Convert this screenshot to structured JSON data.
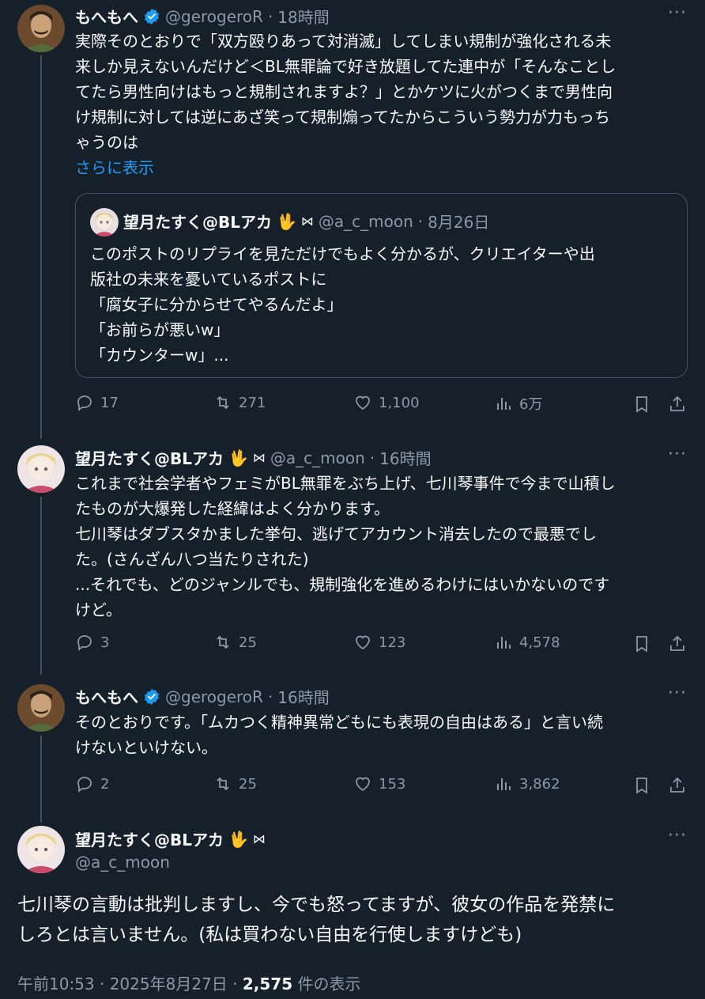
{
  "tweet1": {
    "name": "もへもへ",
    "handle": "@gerogeroR",
    "time": "18時間",
    "body": "実際そのとおりで「双方殴りあって対消滅」してしまい規制が強化される未\n来しか見えないんだけど＜BL無罪論で好き放題してた連中が「そんなことし\nてたら男性向けはもっと規制されますよ？」とかケツに火がつくまで男性向\nけ規制に対しては逆にあざ笑って規制煽ってたからこういう勢力が力もっち\nゃうのは",
    "show_more": "さらに表示",
    "quote": {
      "name": "望月たすく@BLアカ",
      "handle": "@a_c_moon",
      "time": "8月26日",
      "body": "このポストのリプライを見ただけでもよく分かるが、クリエイターや出\n版社の未来を憂いているポストに\n「腐女子に分からせてやるんだよ」\n「お前らが悪いw」\n「カウンターw」..."
    },
    "stats": {
      "replies": "17",
      "reposts": "271",
      "likes": "1,100",
      "views": "6万"
    }
  },
  "tweet2": {
    "name": "望月たすく@BLアカ",
    "handle": "@a_c_moon",
    "time": "16時間",
    "body": "これまで社会学者やフェミがBL無罪をぶち上げ、七川琴事件で今まで山積し\nたものが大爆発した経緯はよく分かります。\n七川琴はダブスタかました挙句、逃げてアカウント消去したので最悪でし\nた。(さんざん八つ当たりされた)\n...それでも、どのジャンルでも、規制強化を進めるわけにはいかないのです\nけど。",
    "stats": {
      "replies": "3",
      "reposts": "25",
      "likes": "123",
      "views": "4,578"
    }
  },
  "tweet3": {
    "name": "もへもへ",
    "handle": "@gerogeroR",
    "time": "16時間",
    "body": "そのとおりです。「ムカつく精神異常どもにも表現の自由はある」と言い続\nけないといけない。",
    "stats": {
      "replies": "2",
      "reposts": "25",
      "likes": "153",
      "views": "3,862"
    }
  },
  "main": {
    "name": "望月たすく@BLアカ",
    "handle": "@a_c_moon",
    "body": "七川琴の言動は批判しますし、今でも怒ってますが、彼女の作品を発禁に\nしろとは言いません。(私は買わない自由を行使しますけども)",
    "timestamp": "午前10:53 · 2025年8月27日 · ",
    "views_count": "2,575",
    "views_label": " 件の表示"
  },
  "emoji": {
    "hand": "🖖",
    "bowtie": "⋈"
  },
  "separator": "·",
  "more": "···",
  "colors": {
    "background": "#15202b",
    "text": "#f7f9f9",
    "muted": "#8b98a5",
    "link": "#1d9bf0",
    "verified": "#1d9bf0",
    "border": "#425364"
  }
}
